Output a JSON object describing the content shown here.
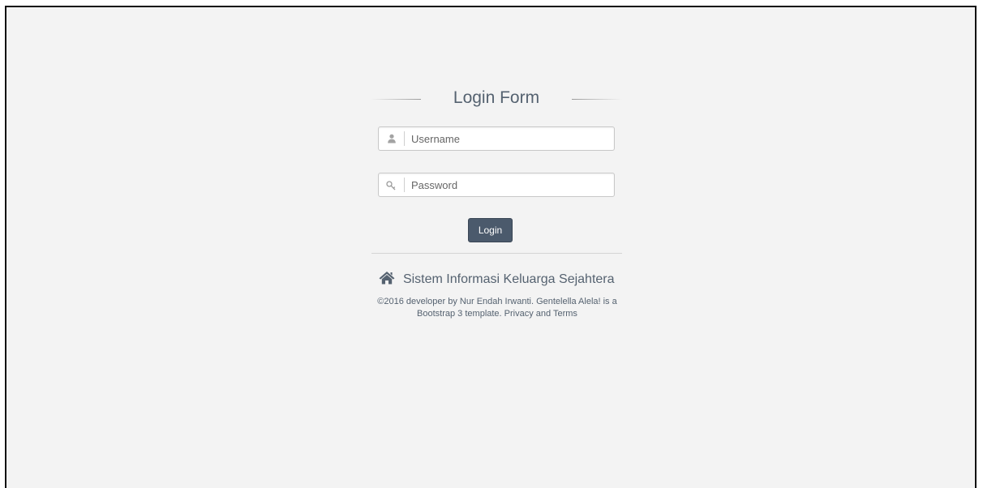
{
  "login": {
    "title": "Login Form",
    "username_placeholder": "Username",
    "username_value": "",
    "password_placeholder": "Password",
    "password_value": "",
    "submit_label": "Login"
  },
  "footer": {
    "brand_icon": "home-icon",
    "brand_name": "Sistem Informasi Keluarga Sejahtera",
    "copyright": "©2016 developer by Nur Endah Irwanti. Gentelella Alela! is a Bootstrap 3 template. Privacy and Terms"
  },
  "icons": {
    "username": "user-icon",
    "password": "key-icon"
  },
  "colors": {
    "background": "#f3f3f3",
    "text": "#556270",
    "button": "#4b5a6c"
  }
}
